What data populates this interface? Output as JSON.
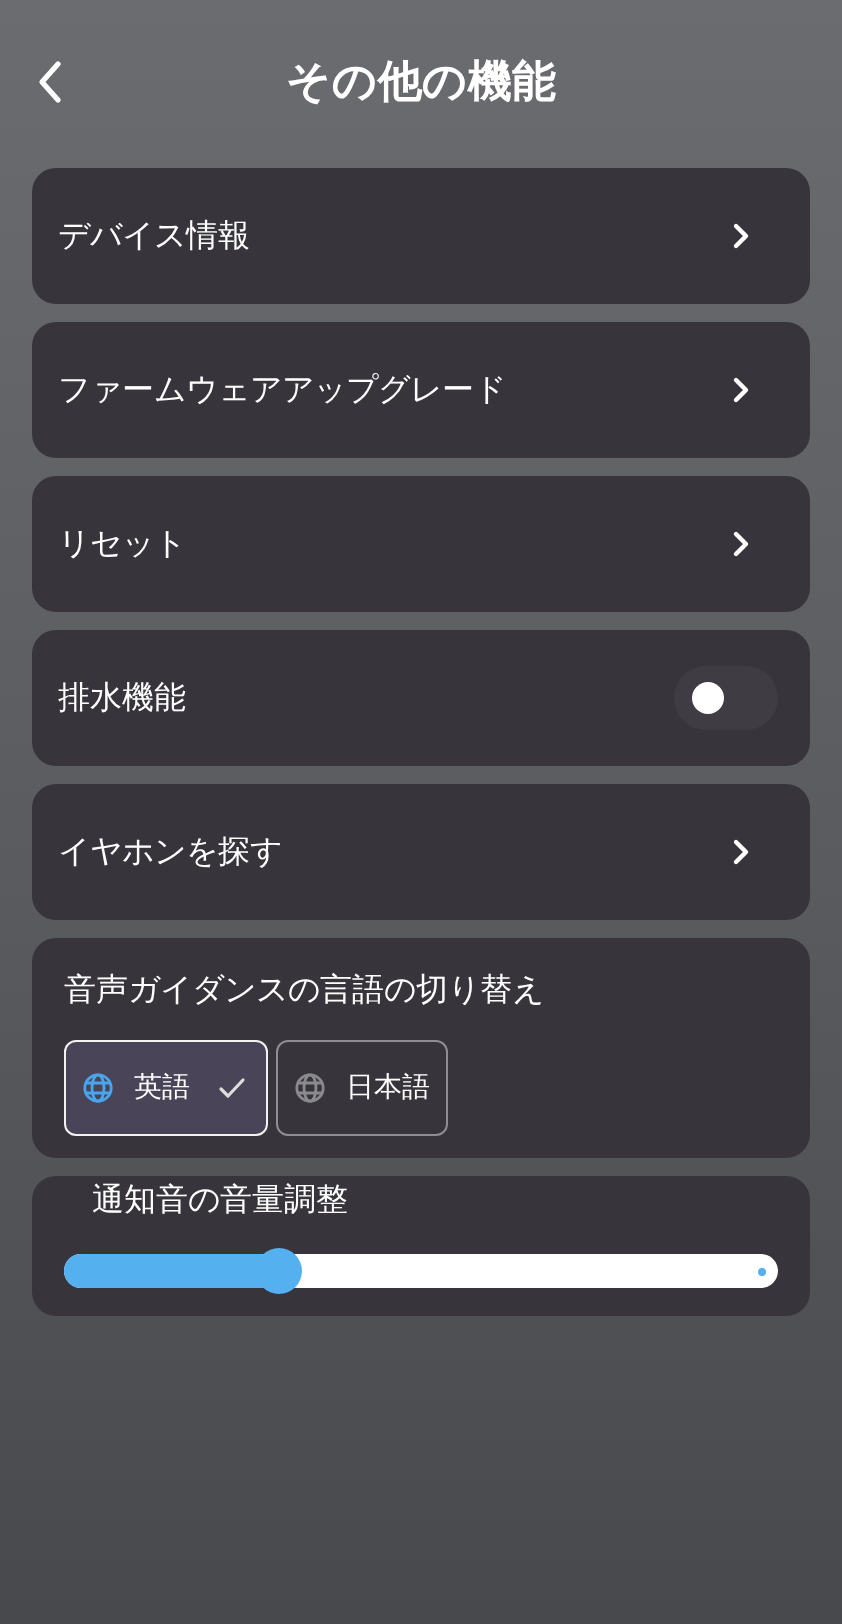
{
  "header": {
    "title": "その他の機能"
  },
  "items": [
    {
      "kind": "link",
      "label": "デバイス情報"
    },
    {
      "kind": "link",
      "label": "ファームウェアアップグレード"
    },
    {
      "kind": "link",
      "label": "リセット"
    },
    {
      "kind": "toggle",
      "label": "排水機能",
      "on": false
    },
    {
      "kind": "link",
      "label": "イヤホンを探す"
    }
  ],
  "language": {
    "title": "音声ガイダンスの言語の切り替え",
    "options": [
      {
        "label": "英語",
        "selected": true
      },
      {
        "label": "日本語",
        "selected": false
      }
    ]
  },
  "volume": {
    "title": "通知音の音量調整",
    "level": 0.3
  }
}
